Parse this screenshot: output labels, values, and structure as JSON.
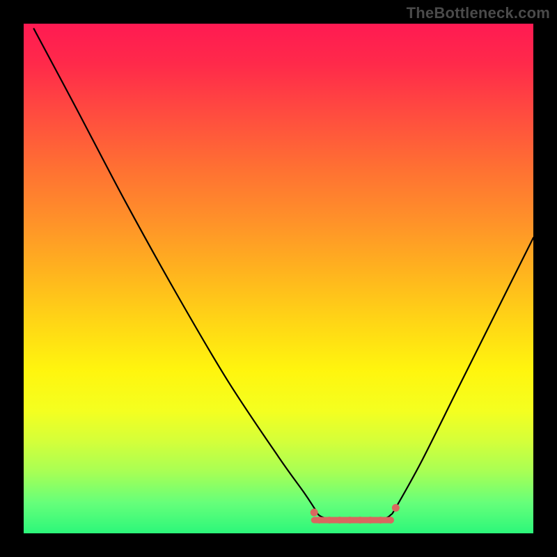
{
  "watermark": "TheBottleneck.com",
  "colors": {
    "curve": "#000000",
    "marker": "#d9675f",
    "flat_stroke": "#d9675f"
  },
  "chart_data": {
    "type": "line",
    "title": "",
    "xlabel": "",
    "ylabel": "",
    "xlim": [
      0,
      100
    ],
    "ylim": [
      0,
      100
    ],
    "grid": false,
    "legend": false,
    "curve": {
      "description": "V-shaped bottleneck curve: steep near-linear descent from top-left to a flat optimum band, then slower rise toward upper-right.",
      "points_xy": [
        [
          2,
          99
        ],
        [
          10,
          84
        ],
        [
          20,
          65
        ],
        [
          30,
          47
        ],
        [
          40,
          30
        ],
        [
          50,
          15
        ],
        [
          55,
          8
        ],
        [
          57,
          5
        ],
        [
          58,
          3.5
        ],
        [
          60,
          2.8
        ],
        [
          63,
          2.5
        ],
        [
          66,
          2.5
        ],
        [
          69,
          2.6
        ],
        [
          71,
          3.0
        ],
        [
          72,
          3.6
        ],
        [
          73,
          5
        ],
        [
          78,
          14
        ],
        [
          85,
          28
        ],
        [
          92,
          42
        ],
        [
          100,
          58
        ]
      ]
    },
    "flat_region": {
      "x_start": 57,
      "x_end": 72,
      "y": 2.6,
      "marker_xs": [
        58,
        60,
        62,
        64,
        66,
        68,
        70,
        72
      ],
      "end_markers_x": [
        57,
        73
      ]
    }
  }
}
